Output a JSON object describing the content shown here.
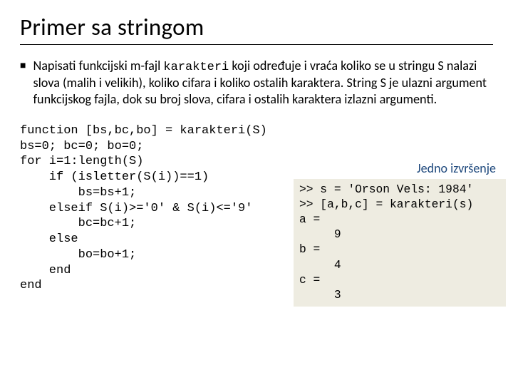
{
  "title": "Primer sa stringom",
  "bullet": {
    "p1": "Napisati funkcijski m-fajl ",
    "code": "karakteri",
    "p2": " koji određuje i vraća koliko se u stringu S nalazi slova (malih i velikih), koliko cifara i koliko ostalih karaktera. String S je ulazni argument funkcijskog fajla, dok su broj slova, cifara i ostalih karaktera izlazni argumenti."
  },
  "code": "function [bs,bc,bo] = karakteri(S)\nbs=0; bc=0; bo=0;\nfor i=1:length(S)\n    if (isletter(S(i))==1)\n        bs=bs+1;\n    elseif S(i)>='0' & S(i)<='9'\n        bc=bc+1;\n    else\n        bo=bo+1;\n    end\nend",
  "output_label": "Jedno izvršenje",
  "output": ">> s = 'Orson Vels: 1984'\n>> [a,b,c] = karakteri(s)\na =\n     9\nb =\n     4\nc =\n     3"
}
